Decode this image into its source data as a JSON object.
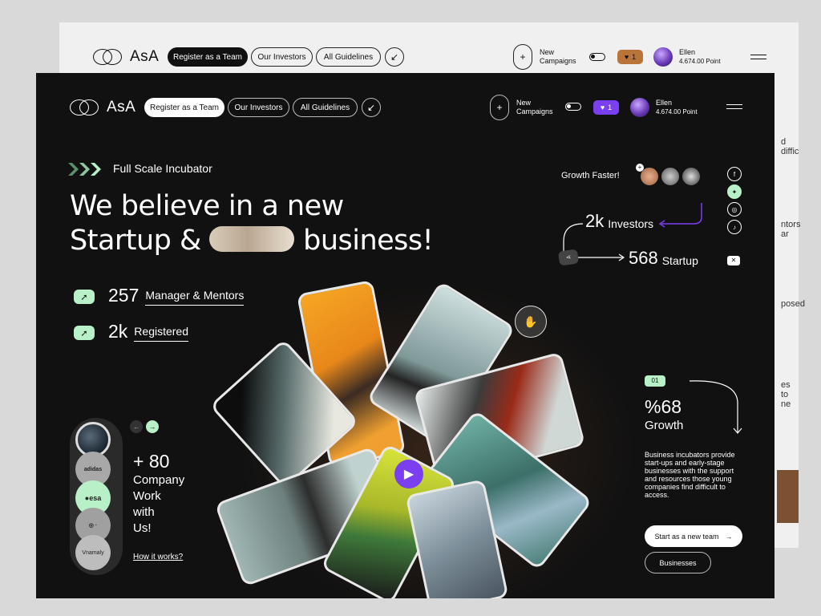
{
  "brand": {
    "name": "AsA"
  },
  "nav": {
    "register_label": "Register as a Team",
    "investors_label": "Our Investors",
    "guidelines_label": "All Guidelines",
    "new_campaigns_label_line1": "New",
    "new_campaigns_label_line2": "Campaigns",
    "likes_count": "1",
    "user_name": "Ellen",
    "user_points": "4.674.00 Point"
  },
  "hero": {
    "eyebrow": "Full Scale Incubator",
    "headline_line1": "We believe in a new",
    "headline_line2_a": "Startup &",
    "headline_line2_b": "business!"
  },
  "stats": [
    {
      "number": "257",
      "label": "Manager & Mentors"
    },
    {
      "number": "2k",
      "label": "Registered"
    }
  ],
  "companies": {
    "logos": [
      "esa-planet",
      "adidas",
      "esa",
      "coca-logo",
      "Vnamaly"
    ],
    "count": "+ 80",
    "line1": "Company",
    "line2": "Work",
    "line3": "with",
    "line4": "Us!",
    "link": "How it works?"
  },
  "growth_faster": {
    "label": "Growth Faster!",
    "investors_number": "2k",
    "investors_label": "Investors",
    "startup_number": "568",
    "startup_label": "Startup"
  },
  "growth_card": {
    "index": "01",
    "percent": "%68",
    "label": "Growth",
    "description": "Business incubators provide start-ups and early-stage businesses with the support and resources those young companies find difficult to access.",
    "primary_cta": "Start as a new team",
    "secondary_cta": "Businesses"
  },
  "background_window": {
    "side_text_1": "d diffic",
    "side_text_2": "ntors ar",
    "side_text_3": "posed",
    "side_text_4": "es to ne"
  },
  "social": [
    "facebook-icon",
    "twitter-icon",
    "instagram-icon",
    "tiktok-icon"
  ],
  "colors": {
    "accent_green": "#b8f0c8",
    "accent_purple": "#7b3ff2",
    "badge_brown": "#b9743a",
    "dark_bg": "#111111"
  }
}
